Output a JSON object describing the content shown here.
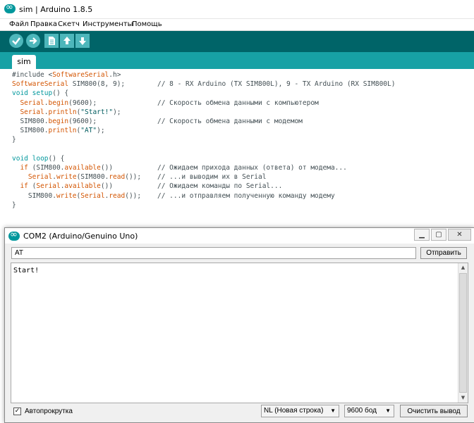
{
  "ide": {
    "title": "sim | Arduino 1.8.5",
    "menu": [
      "Файл",
      "Правка",
      "Скетч",
      "Инструменты",
      "Помощь"
    ],
    "tab": "sim",
    "code": [
      {
        "segments": [
          {
            "t": "#include <",
            "c": ""
          },
          {
            "t": "SoftwareSerial",
            "c": "kw-orange"
          },
          {
            "t": ".h>",
            "c": ""
          }
        ],
        "comment": ""
      },
      {
        "segments": [
          {
            "t": "SoftwareSerial",
            "c": "kw-orange"
          },
          {
            "t": " SIM800(8, 9);",
            "c": ""
          }
        ],
        "comment": "// 8 - RX Arduino (TX SIM800L), 9 - TX Arduino (RX SIM800L)"
      },
      {
        "segments": [
          {
            "t": "void",
            "c": "kw-teal"
          },
          {
            "t": " ",
            "c": ""
          },
          {
            "t": "setup",
            "c": "kw-teal"
          },
          {
            "t": "() {",
            "c": ""
          }
        ],
        "comment": ""
      },
      {
        "segments": [
          {
            "t": "  ",
            "c": ""
          },
          {
            "t": "Serial",
            "c": "kw-orange"
          },
          {
            "t": ".",
            "c": ""
          },
          {
            "t": "begin",
            "c": "kw-orange"
          },
          {
            "t": "(9600);",
            "c": ""
          }
        ],
        "comment": "// Скорость обмена данными с компьютером"
      },
      {
        "segments": [
          {
            "t": "  ",
            "c": ""
          },
          {
            "t": "Serial",
            "c": "kw-orange"
          },
          {
            "t": ".",
            "c": ""
          },
          {
            "t": "println",
            "c": "kw-orange"
          },
          {
            "t": "(",
            "c": ""
          },
          {
            "t": "\"Start!\"",
            "c": "str"
          },
          {
            "t": ");",
            "c": ""
          }
        ],
        "comment": ""
      },
      {
        "segments": [
          {
            "t": "  SIM800.",
            "c": ""
          },
          {
            "t": "begin",
            "c": "kw-orange"
          },
          {
            "t": "(9600);",
            "c": ""
          }
        ],
        "comment": "// Скорость обмена данными с модемом"
      },
      {
        "segments": [
          {
            "t": "  SIM800.",
            "c": ""
          },
          {
            "t": "println",
            "c": "kw-orange"
          },
          {
            "t": "(",
            "c": ""
          },
          {
            "t": "\"AT\"",
            "c": "str"
          },
          {
            "t": ");",
            "c": ""
          }
        ],
        "comment": ""
      },
      {
        "segments": [
          {
            "t": "}",
            "c": ""
          }
        ],
        "comment": ""
      },
      {
        "segments": [],
        "comment": ""
      },
      {
        "segments": [
          {
            "t": "void",
            "c": "kw-teal"
          },
          {
            "t": " ",
            "c": ""
          },
          {
            "t": "loop",
            "c": "kw-teal"
          },
          {
            "t": "() {",
            "c": ""
          }
        ],
        "comment": ""
      },
      {
        "segments": [
          {
            "t": "  ",
            "c": ""
          },
          {
            "t": "if",
            "c": "kw-orange"
          },
          {
            "t": " (SIM800.",
            "c": ""
          },
          {
            "t": "available",
            "c": "kw-orange"
          },
          {
            "t": "())",
            "c": ""
          }
        ],
        "comment": "// Ожидаем прихода данных (ответа) от модема..."
      },
      {
        "segments": [
          {
            "t": "    ",
            "c": ""
          },
          {
            "t": "Serial",
            "c": "kw-orange"
          },
          {
            "t": ".",
            "c": ""
          },
          {
            "t": "write",
            "c": "kw-orange"
          },
          {
            "t": "(SIM800.",
            "c": ""
          },
          {
            "t": "read",
            "c": "kw-orange"
          },
          {
            "t": "());",
            "c": ""
          }
        ],
        "comment": "// ...и выводим их в Serial"
      },
      {
        "segments": [
          {
            "t": "  ",
            "c": ""
          },
          {
            "t": "if",
            "c": "kw-orange"
          },
          {
            "t": " (",
            "c": ""
          },
          {
            "t": "Serial",
            "c": "kw-orange"
          },
          {
            "t": ".",
            "c": ""
          },
          {
            "t": "available",
            "c": "kw-orange"
          },
          {
            "t": "())",
            "c": ""
          }
        ],
        "comment": "// Ожидаем команды по Serial..."
      },
      {
        "segments": [
          {
            "t": "    SIM800.",
            "c": ""
          },
          {
            "t": "write",
            "c": "kw-orange"
          },
          {
            "t": "(",
            "c": ""
          },
          {
            "t": "Serial",
            "c": "kw-orange"
          },
          {
            "t": ".",
            "c": ""
          },
          {
            "t": "read",
            "c": "kw-orange"
          },
          {
            "t": "());",
            "c": ""
          }
        ],
        "comment": "// ...и отправляем полученную команду модему"
      },
      {
        "segments": [
          {
            "t": "}",
            "c": ""
          }
        ],
        "comment": ""
      }
    ]
  },
  "monitor": {
    "title": "COM2 (Arduino/Genuino Uno)",
    "input_value": "AT",
    "send_label": "Отправить",
    "output": "Start!",
    "autoscroll_label": "Автопрокрутка",
    "autoscroll_checked": true,
    "line_ending": "NL (Новая строка)",
    "baud": "9600 бод",
    "clear_label": "Очистить вывод"
  },
  "colors": {
    "toolbar": "#006468",
    "tabbar": "#17a1a5",
    "button": "#4db7bb",
    "keyword": "#d35400",
    "keyword_teal": "#00979c"
  },
  "icons": {
    "verify": "checkmark-icon",
    "upload": "arrow-right-icon",
    "new": "new-file-icon",
    "open": "arrow-up-icon",
    "save": "arrow-down-icon"
  }
}
